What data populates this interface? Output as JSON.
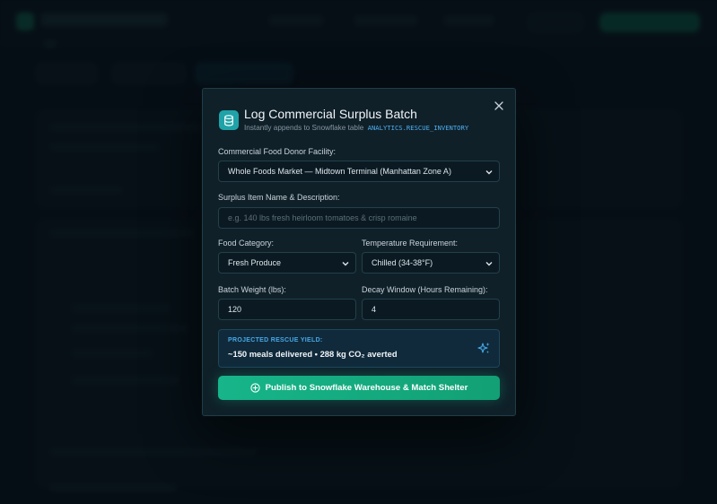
{
  "modal": {
    "title": "Log Commercial Surplus Batch",
    "subtitle_prefix": "Instantly appends to Snowflake table",
    "table_name": "ANALYTICS.RESCUE_INVENTORY",
    "close_icon": "close-icon",
    "header_icon": "database-icon"
  },
  "form": {
    "donor_label": "Commercial Food Donor Facility:",
    "donor_value": "Whole Foods Market — Midtown Terminal (Manhattan Zone A)",
    "item_label": "Surplus Item Name & Description:",
    "item_placeholder": "e.g. 140 lbs fresh heirloom tomatoes & crisp romaine",
    "category_label": "Food Category:",
    "category_value": "Fresh Produce",
    "temp_label": "Temperature Requirement:",
    "temp_value": "Chilled (34-38°F)",
    "weight_label": "Batch Weight (lbs):",
    "weight_value": "120",
    "decay_label": "Decay Window (Hours Remaining):",
    "decay_value": "4"
  },
  "yield": {
    "kicker": "PROJECTED RESCUE YIELD:",
    "value": "~150 meals delivered • 288 kg CO₂ averted",
    "icon": "sparkles-icon"
  },
  "publish": {
    "label": "Publish to Snowflake Warehouse & Match Shelter",
    "icon": "plus-circle-icon"
  },
  "colors": {
    "accent": "#17b58a",
    "info": "#46a8e8",
    "modal_bg": "#0f2029"
  }
}
